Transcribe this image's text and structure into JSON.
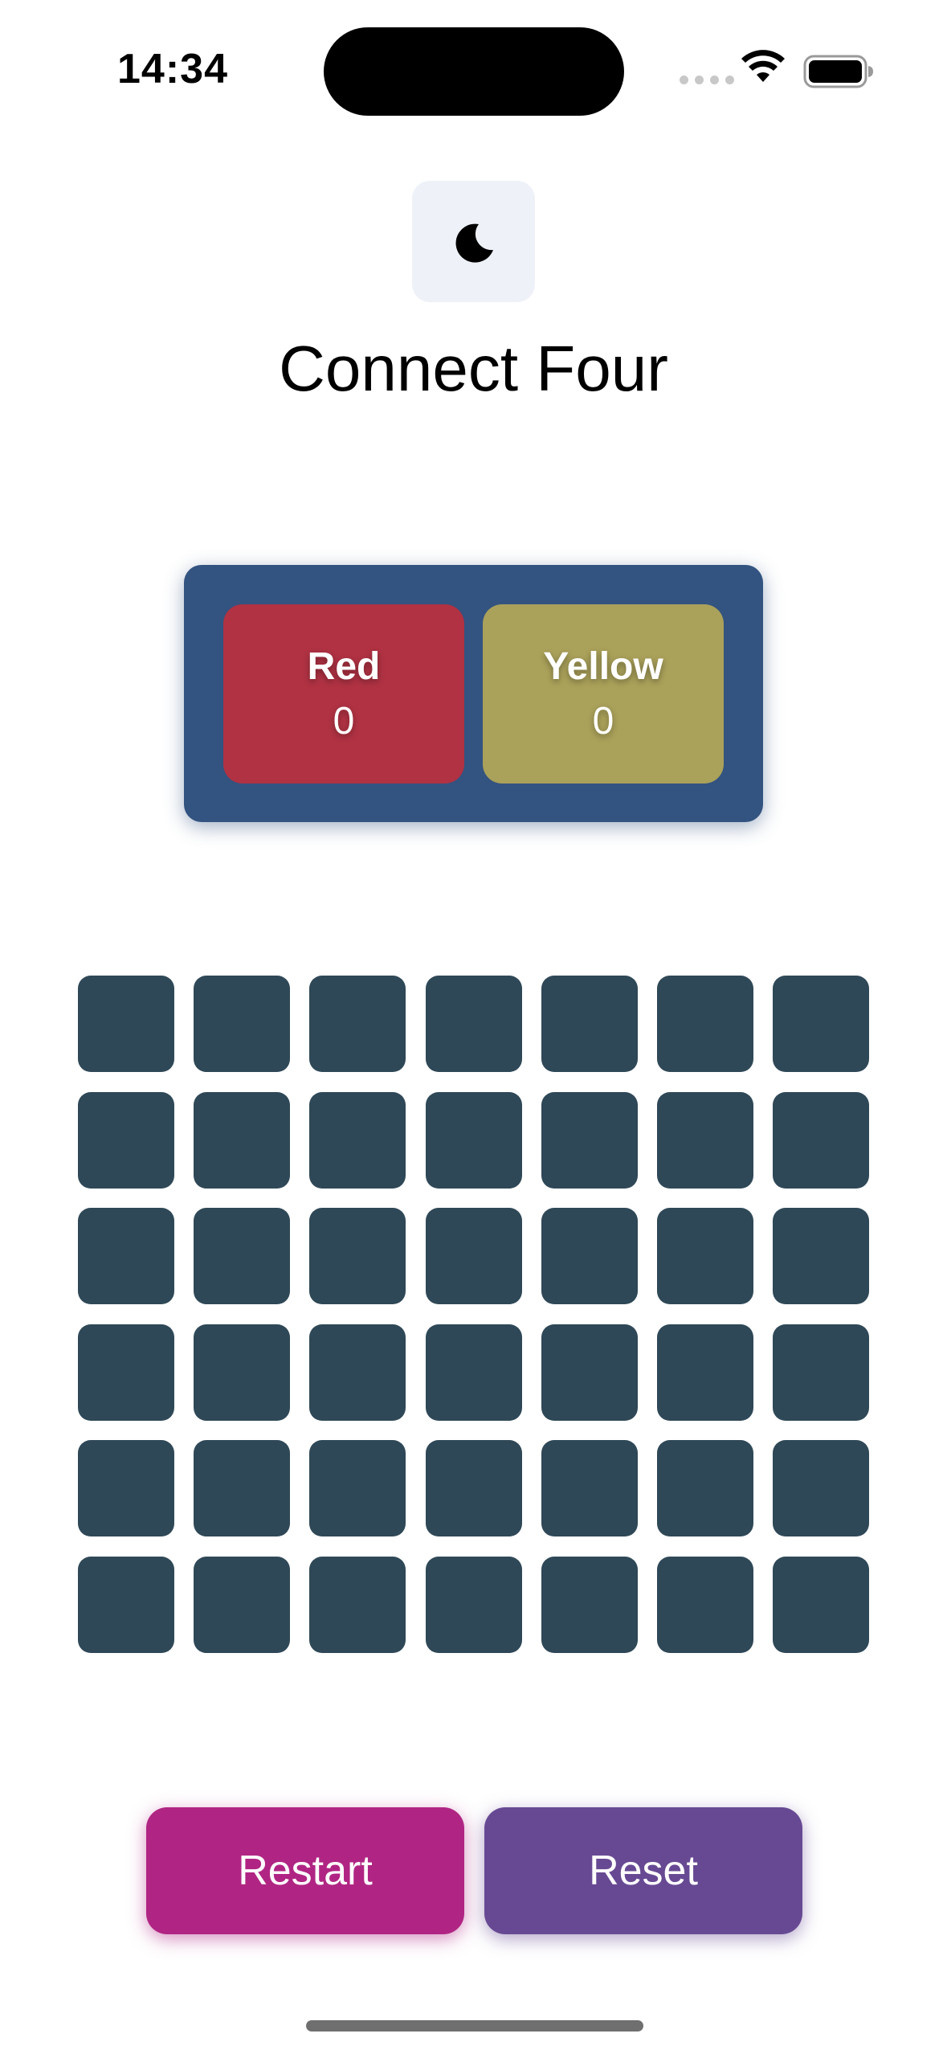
{
  "status_bar": {
    "time": "14:34"
  },
  "header": {
    "theme_toggle_icon": "moon-icon",
    "title": "Connect Four"
  },
  "scoreboard": {
    "red": {
      "label": "Red",
      "score": "0",
      "color": "#b03243"
    },
    "yellow": {
      "label": "Yellow",
      "score": "0",
      "color": "#aaa15a"
    },
    "panel_color": "#335380"
  },
  "board": {
    "columns": 7,
    "rows": 6,
    "cell_color": "#2f4857",
    "cells": [
      [
        "",
        "",
        "",
        "",
        "",
        "",
        ""
      ],
      [
        "",
        "",
        "",
        "",
        "",
        "",
        ""
      ],
      [
        "",
        "",
        "",
        "",
        "",
        "",
        ""
      ],
      [
        "",
        "",
        "",
        "",
        "",
        "",
        ""
      ],
      [
        "",
        "",
        "",
        "",
        "",
        "",
        ""
      ],
      [
        "",
        "",
        "",
        "",
        "",
        "",
        ""
      ]
    ]
  },
  "actions": {
    "restart_label": "Restart",
    "reset_label": "Reset",
    "restart_color": "#b02583",
    "reset_color": "#674993"
  }
}
